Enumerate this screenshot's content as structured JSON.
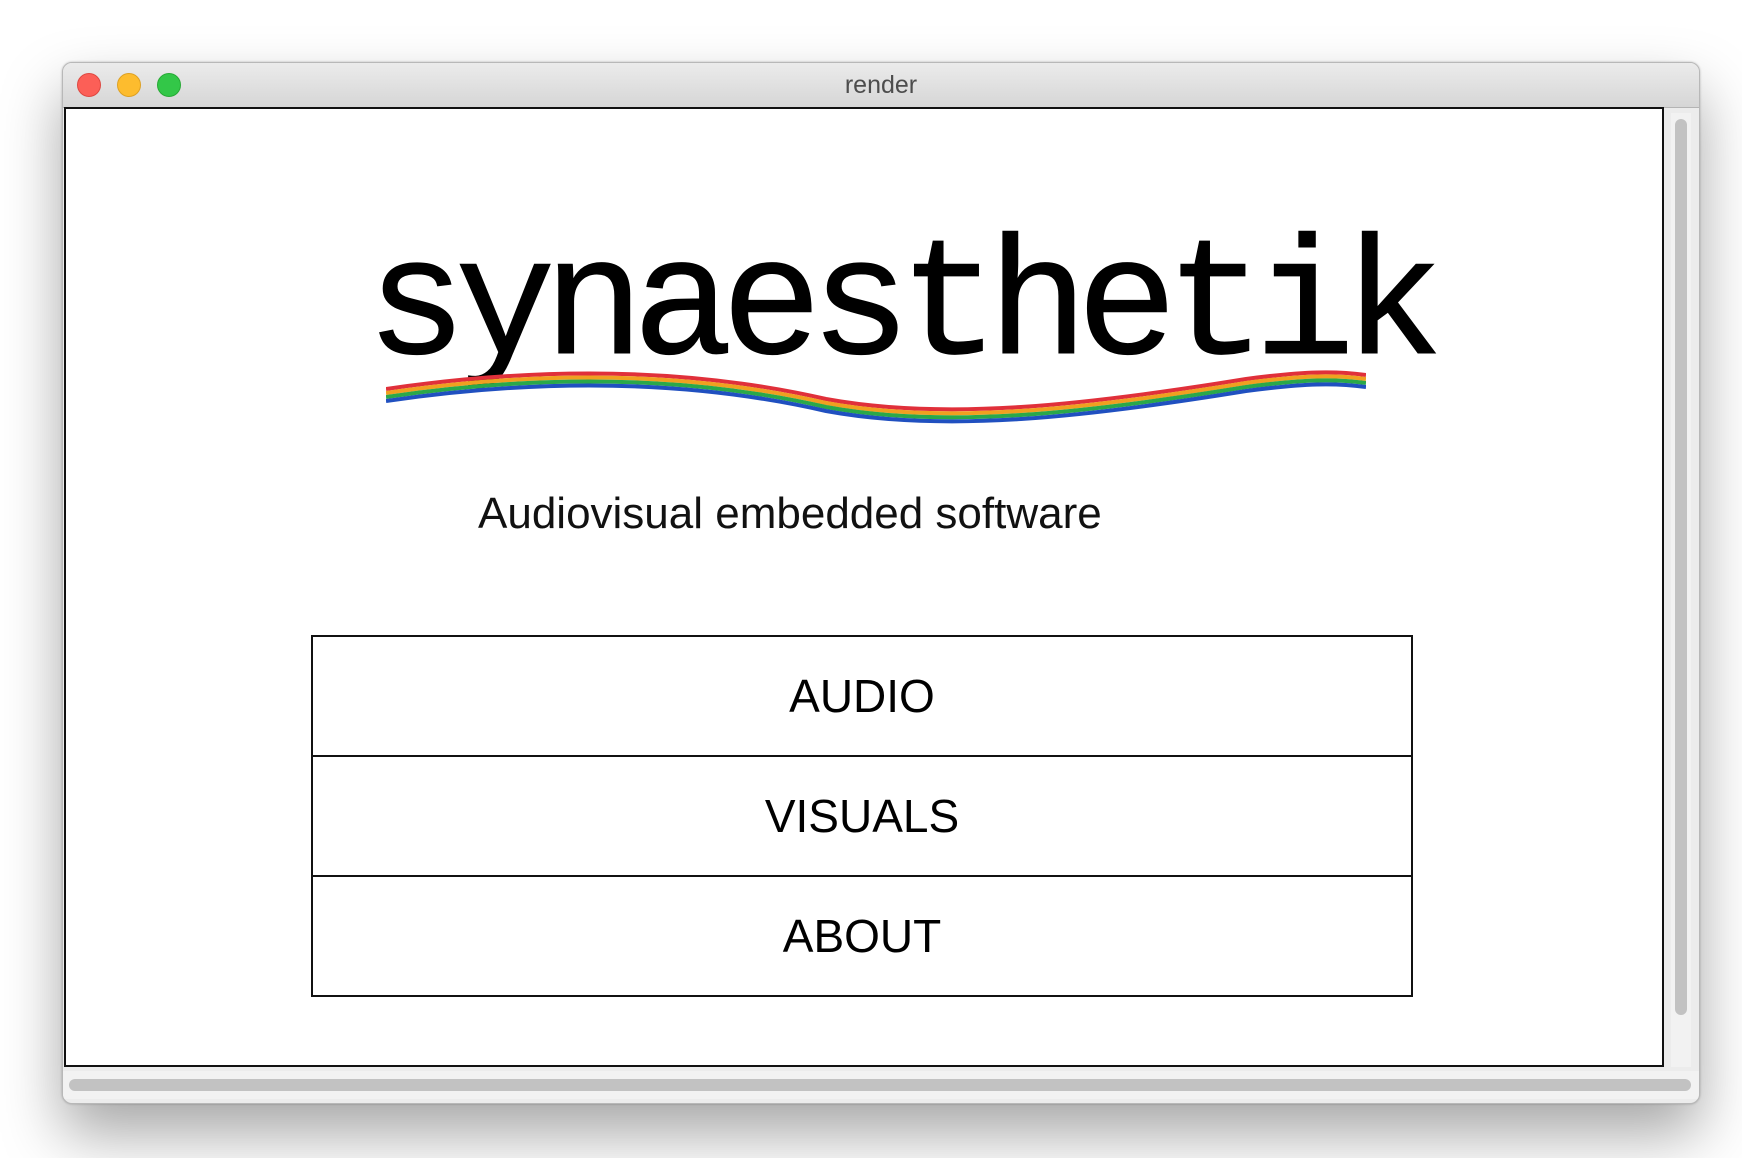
{
  "window": {
    "title": "render"
  },
  "logo": {
    "wordmark": "synaesthetik"
  },
  "subtitle": "Audiovisual embedded software",
  "menu": {
    "items": [
      {
        "label": "AUDIO"
      },
      {
        "label": "VISUALS"
      },
      {
        "label": "ABOUT"
      }
    ]
  },
  "colors": {
    "wave": [
      "#e0303a",
      "#f0a020",
      "#2aa84a",
      "#2050c0"
    ]
  }
}
